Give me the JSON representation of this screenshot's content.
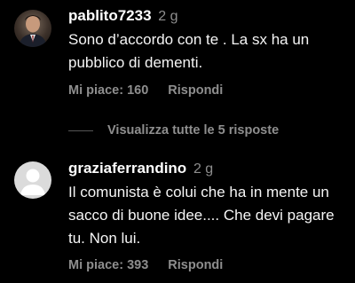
{
  "comments": [
    {
      "username": "pablito7233",
      "time": "2 g",
      "text": "Sono d’accordo con te . La sx ha un pubblico di dementi.",
      "likes": "Mi piace: 160",
      "reply": "Rispondi",
      "avatar_icon": "user-photo-icon"
    },
    {
      "username": "graziaferrandino",
      "time": "2 g",
      "text": "Il comunista è colui che ha in mente un sacco di buone idee.... Che devi pagare tu. Non lui.",
      "likes": "Mi piace: 393",
      "reply": "Rispondi",
      "avatar_icon": "default-avatar-icon"
    }
  ],
  "view_replies": {
    "label": "Visualizza tutte le 5 risposte"
  },
  "colors": {
    "background": "#000000",
    "primary_text": "#ffffff",
    "secondary_text": "#8e8e8e",
    "default_avatar_bg": "#dbdbdb",
    "default_avatar_fg": "#ffffff"
  }
}
